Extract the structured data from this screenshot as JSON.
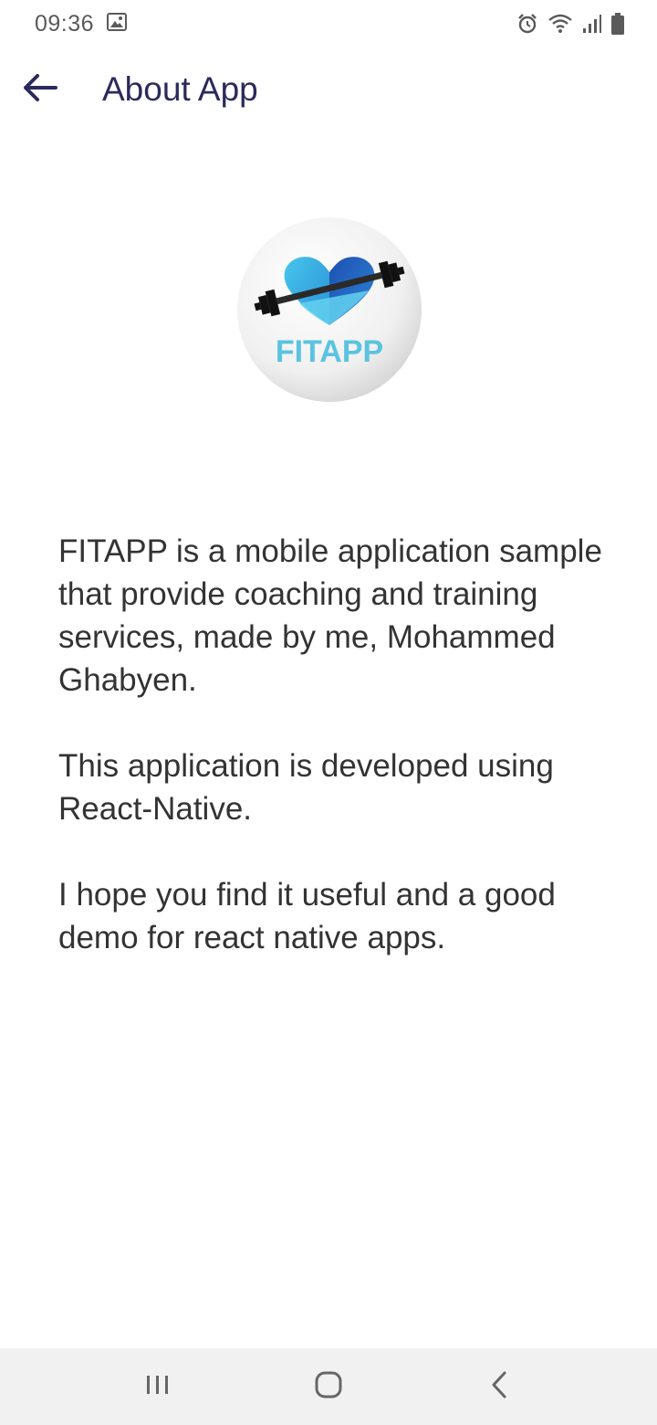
{
  "status_bar": {
    "time": "09:36",
    "icons": [
      "image-icon",
      "alarm-icon",
      "wifi-icon",
      "signal-icon",
      "battery-icon"
    ]
  },
  "app_bar": {
    "title": "About App",
    "back_icon": "arrow-left-icon"
  },
  "logo": {
    "text": "FITAPP",
    "icon": "heart-dumbbell-logo",
    "colors": {
      "brand_text": "#5bc3df",
      "heart_dark": "#1f5fbf",
      "heart_light": "#4cc4ea",
      "bar": "#1a1a1a"
    }
  },
  "about": {
    "paragraph_1": "FITAPP is a mobile application sample that provide coaching and training services, made by me, Mohammed Ghabyen.",
    "paragraph_2": "This application is developed using React-Native.",
    "paragraph_3": "I hope you find it useful and a good demo for react native apps."
  },
  "nav_bar": {
    "recents_icon": "recents-icon",
    "home_icon": "home-icon",
    "back_icon": "back-chevron-icon"
  },
  "colors": {
    "title": "#2b2a5c",
    "body_text": "#333333",
    "nav_bg": "#f1f1f1"
  }
}
